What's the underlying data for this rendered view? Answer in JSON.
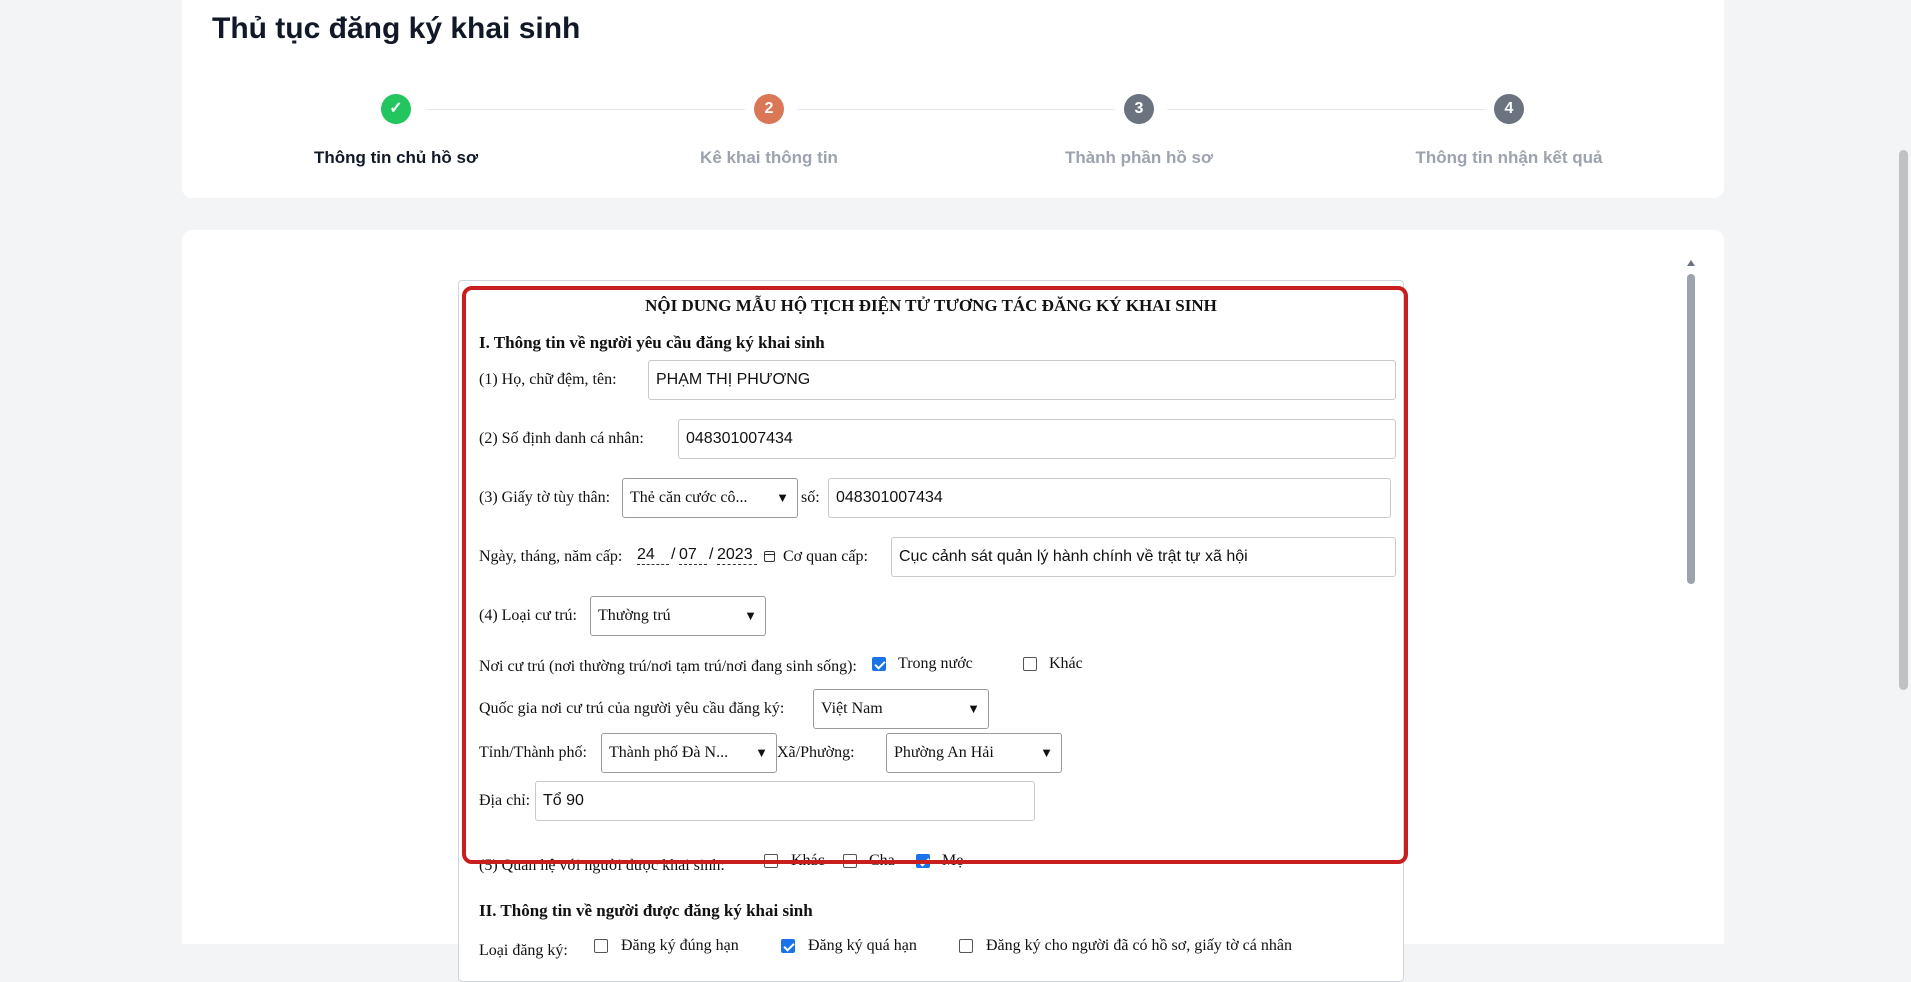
{
  "header": {
    "title": "Thủ tục đăng ký khai sinh",
    "steps": [
      {
        "number": "✓",
        "label": "Thông tin chủ hồ sơ",
        "state": "completed"
      },
      {
        "number": "2",
        "label": "Kê khai thông tin",
        "state": "current"
      },
      {
        "number": "3",
        "label": "Thành phần hồ sơ",
        "state": "pending"
      },
      {
        "number": "4",
        "label": "Thông tin nhận kết quả",
        "state": "pending"
      }
    ]
  },
  "colors": {
    "completed": "#22c55e",
    "current": "#d97757",
    "pending": "#6b7280",
    "highlight": "#c81e1e",
    "checkbox": "#1a73e8"
  },
  "form": {
    "doc_title": "NỘI DUNG MẪU HỘ TỊCH ĐIỆN TỬ TƯƠNG TÁC ĐĂNG KÝ KHAI SINH",
    "section1": "I. Thông tin về người yêu cầu đăng ký khai sinh",
    "name_label": "(1) Họ, chữ đệm, tên:",
    "name_value": "PHẠM THỊ PHƯƠNG",
    "id_label": "(2) Số định danh cá nhân:",
    "id_value": "048301007434",
    "doc_label": "(3) Giấy tờ tùy thân:",
    "doc_type_value": "Thẻ căn cước cô...",
    "doc_no_label": "số:",
    "doc_no_value": "048301007434",
    "issue_date_label": "Ngày, tháng, năm cấp:",
    "issue_day": "24",
    "issue_month": "07",
    "issue_year": "2023",
    "issuer_label": "Cơ quan cấp:",
    "issuer_value": "Cục cảnh sát quản lý hành chính về trật tự xã hội",
    "residence_type_label": "(4) Loại cư trú:",
    "residence_type_value": "Thường trú",
    "residence_place_label": "Nơi cư trú (nơi thường trú/nơi tạm trú/nơi đang sinh sống):",
    "residence_domestic": {
      "label": "Trong nước",
      "checked": true
    },
    "residence_other": {
      "label": "Khác",
      "checked": false
    },
    "country_label": "Quốc gia nơi cư trú của người yêu cầu đăng ký:",
    "country_value": "Việt Nam",
    "province_label": "Tỉnh/Thành phố:",
    "province_value": "Thành phố Đà N...",
    "ward_label": "Xã/Phường:",
    "ward_value": "Phường An Hải",
    "address_label": "Địa chỉ:",
    "address_value": "Tổ 90",
    "relation_label": "(5) Quan hệ với người được khai sinh:",
    "relation_other": {
      "label": "Khác",
      "checked": false
    },
    "relation_father": {
      "label": "Cha",
      "checked": false
    },
    "relation_mother": {
      "label": "Mẹ",
      "checked": true
    },
    "section2": "II. Thông tin về người được đăng ký khai sinh",
    "reg_type_label": "Loại đăng ký:",
    "reg_on_time": {
      "label": "Đăng ký đúng hạn",
      "checked": false
    },
    "reg_late": {
      "label": "Đăng ký quá hạn",
      "checked": true
    },
    "reg_with_docs": {
      "label": "Đăng ký cho người đã có hồ sơ, giấy tờ cá nhân",
      "checked": false
    }
  }
}
